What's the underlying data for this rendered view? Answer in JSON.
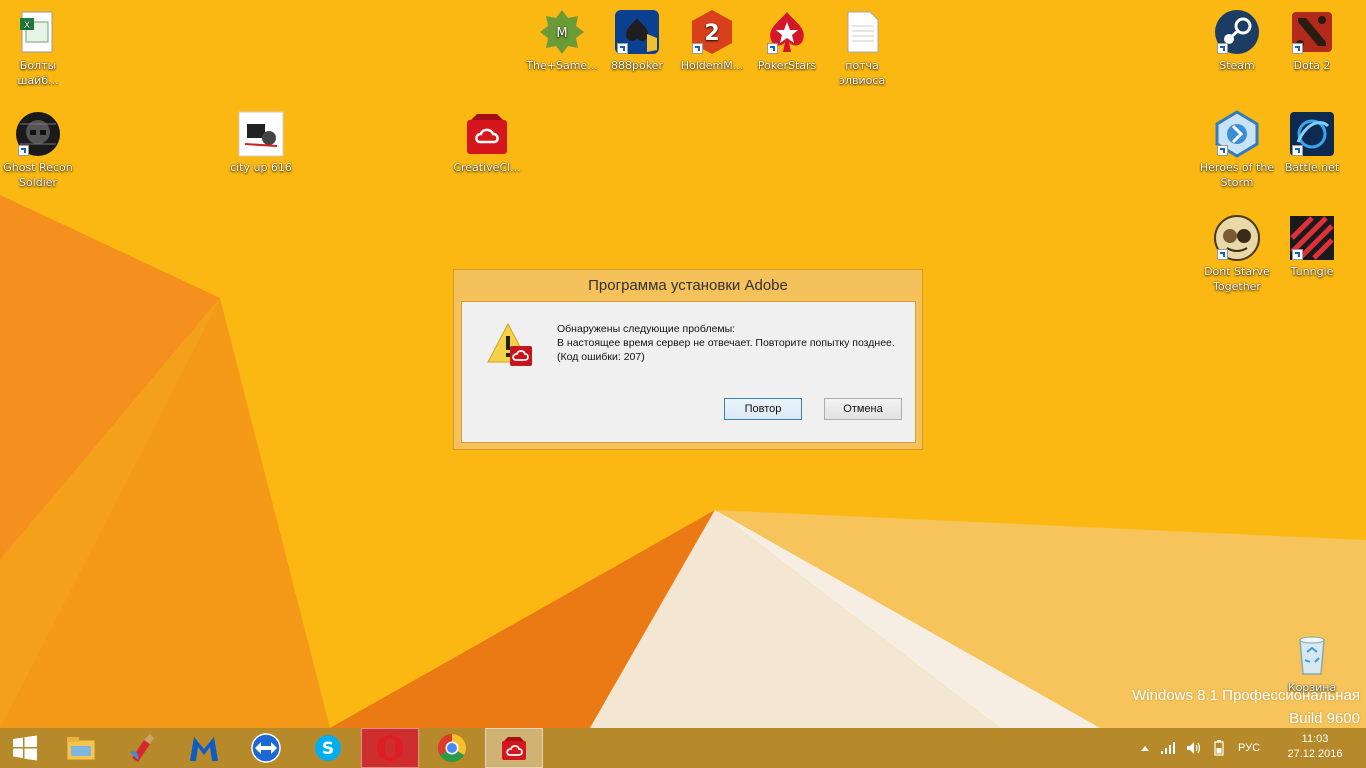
{
  "desktop": {
    "icons": [
      {
        "label": "Болты шайб..."
      },
      {
        "label": "The+Same..."
      },
      {
        "label": "888poker"
      },
      {
        "label": "HoldemM..."
      },
      {
        "label": "PokerStars"
      },
      {
        "label": "потча элвиоса"
      },
      {
        "label": "Steam"
      },
      {
        "label": "Dota 2"
      },
      {
        "label": "Ghost Recon Soldier"
      },
      {
        "label": "city up 616"
      },
      {
        "label": "CreativeCl..."
      },
      {
        "label": "Heroes of the Storm"
      },
      {
        "label": "Battle.net"
      },
      {
        "label": "Dont Starve Together"
      },
      {
        "label": "Tunngle"
      },
      {
        "label": "Корзина"
      }
    ],
    "watermark": {
      "line1": "Windows 8.1 Профессиональная",
      "line2": "Build 9600"
    }
  },
  "dialog": {
    "title": "Программа установки Adobe",
    "heading": "Обнаружены следующие проблемы:",
    "message": "В настоящее время сервер не отвечает. Повторите попытку позднее. (Код ошибки: 207)",
    "retry_label": "Повтор",
    "cancel_label": "Отмена"
  },
  "taskbar": {
    "apps": [
      "start-icon",
      "file-explorer-icon",
      "ccleaner-icon",
      "malwarebytes-icon",
      "teamviewer-icon",
      "skype-icon",
      "opera-icon",
      "chrome-icon",
      "creative-cloud-icon"
    ],
    "tray": {
      "language": "РУС",
      "time": "11:03",
      "date": "27.12.2016"
    }
  },
  "colors": {
    "wallpaper": "#f9b50d",
    "taskbar": "#b68a2a",
    "dialog_frame": "#f5c15b"
  }
}
